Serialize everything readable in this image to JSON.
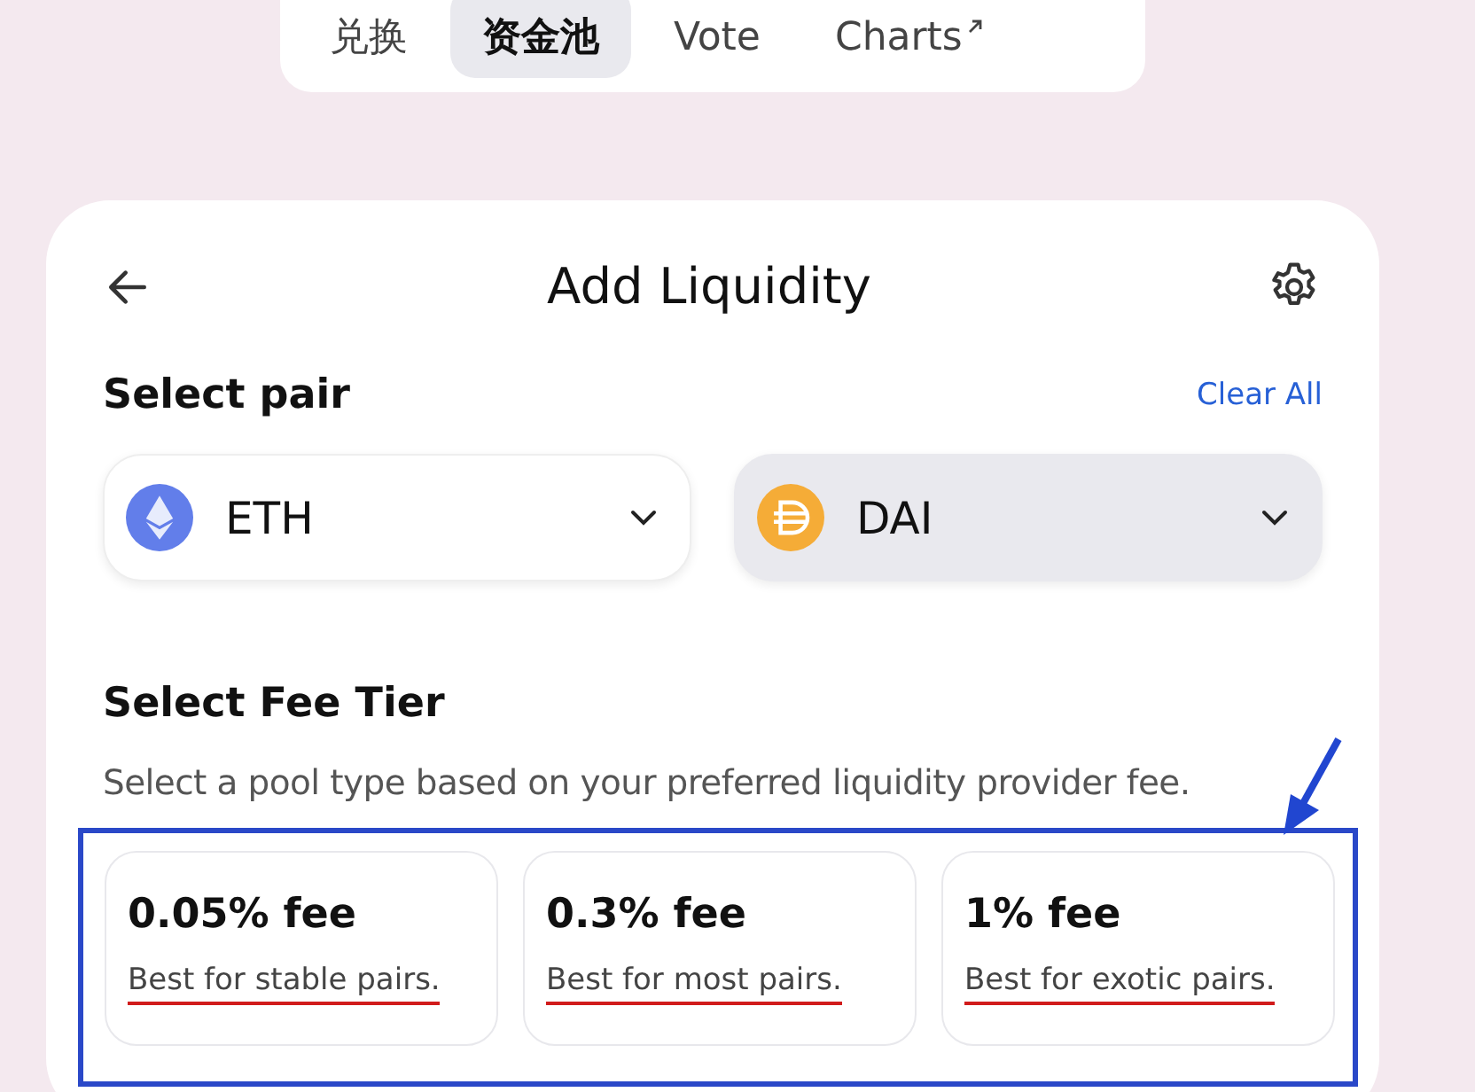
{
  "nav_tabs": [
    {
      "label": "兑换",
      "selected": false,
      "external": false
    },
    {
      "label": "资金池",
      "selected": true,
      "external": false
    },
    {
      "label": "Vote",
      "selected": false,
      "external": false
    },
    {
      "label": "Charts",
      "selected": false,
      "external": true
    }
  ],
  "card": {
    "title": "Add Liquidity",
    "pair": {
      "heading": "Select pair",
      "clear": "Clear All",
      "tokens": [
        {
          "kind": "eth",
          "symbol": "ETH",
          "selected": false
        },
        {
          "kind": "dai",
          "symbol": "DAI",
          "selected": true
        }
      ]
    },
    "fee": {
      "heading": "Select Fee Tier",
      "description": "Select a pool type based on your preferred liquidity provider fee.",
      "highlight_box": true,
      "arrow": true,
      "tiers": [
        {
          "label": "0.05% fee",
          "note": "Best for stable pairs.",
          "underlined": true
        },
        {
          "label": "0.3% fee",
          "note": "Best for most pairs.",
          "underlined": true
        },
        {
          "label": "1% fee",
          "note": "Best for exotic pairs.",
          "underlined": true
        }
      ]
    }
  }
}
